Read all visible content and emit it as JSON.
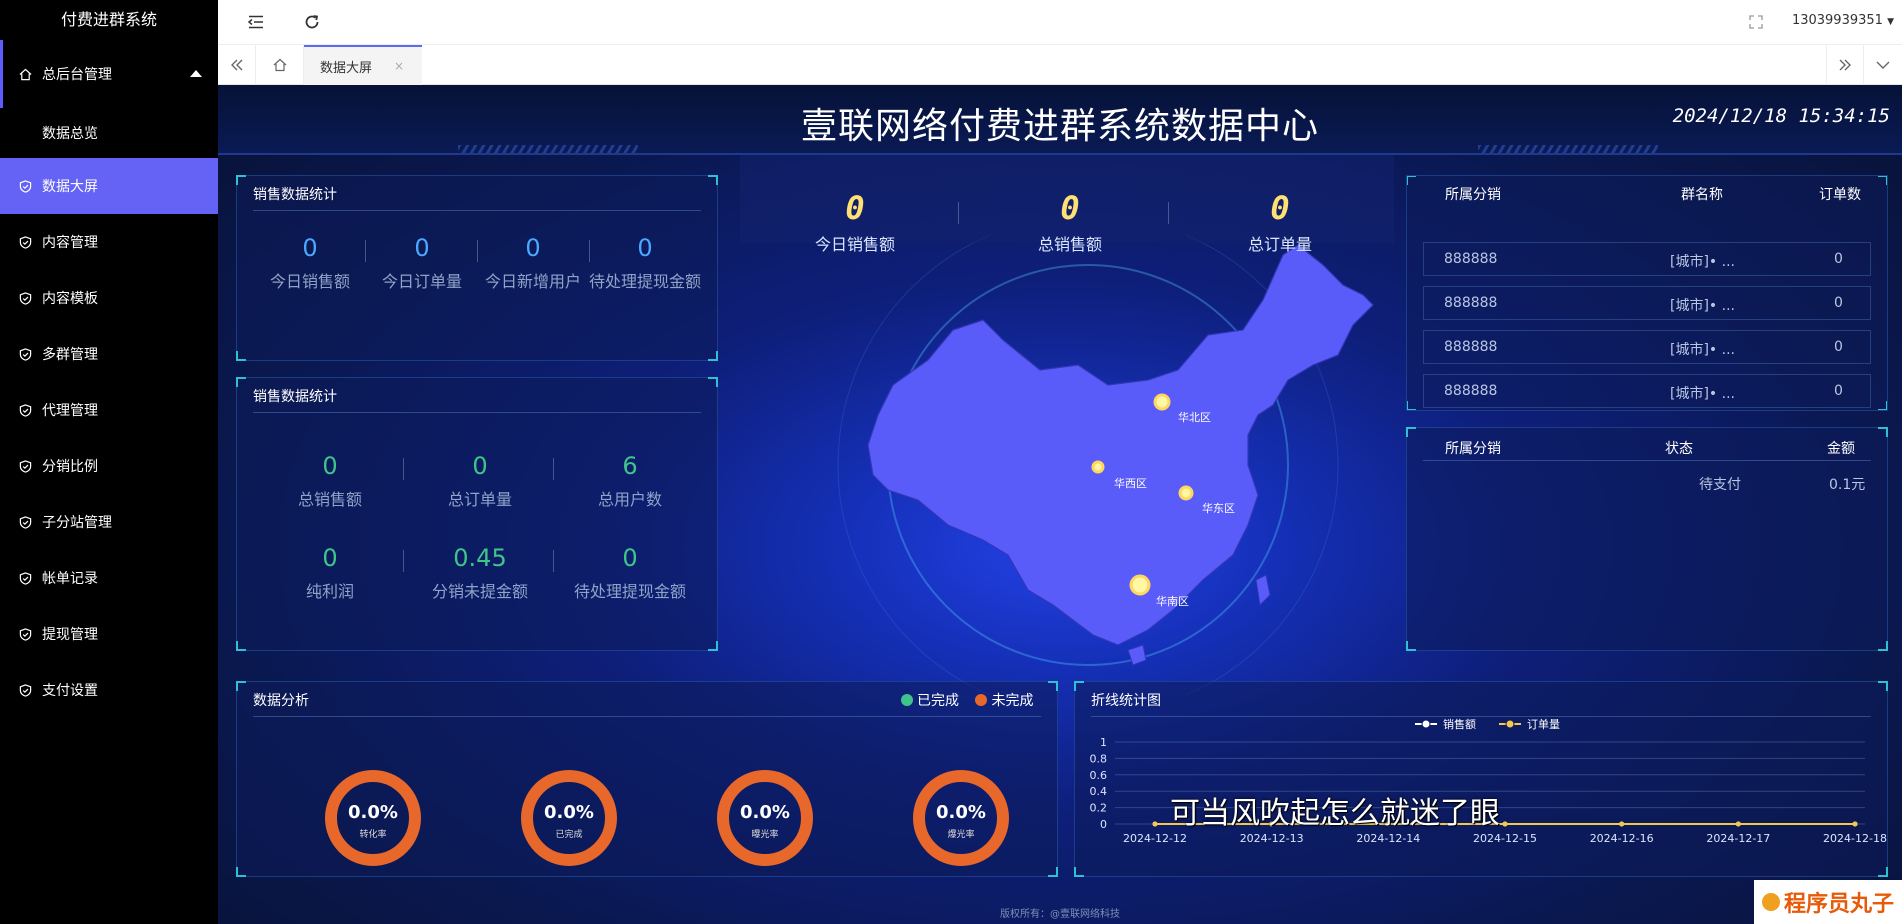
{
  "sidebar": {
    "brand": "付费进群系统",
    "items": [
      {
        "label": "总后台管理"
      },
      {
        "label": "数据总览"
      },
      {
        "label": "数据大屏"
      },
      {
        "label": "内容管理"
      },
      {
        "label": "内容模板"
      },
      {
        "label": "多群管理"
      },
      {
        "label": "代理管理"
      },
      {
        "label": "分销比例"
      },
      {
        "label": "子分站管理"
      },
      {
        "label": "帐单记录"
      },
      {
        "label": "提现管理"
      },
      {
        "label": "支付设置"
      }
    ]
  },
  "topbar": {
    "user": "13039939351"
  },
  "tabs": {
    "active": "数据大屏",
    "close": "×"
  },
  "dashboard": {
    "title": "壹联网络付费进群系统数据中心",
    "time": "2024/12/18 15:34:15",
    "sales_panel": {
      "title": "销售数据统计",
      "stats": [
        {
          "value": "0",
          "label": "今日销售额"
        },
        {
          "value": "0",
          "label": "今日订单量"
        },
        {
          "value": "0",
          "label": "今日新增用户"
        },
        {
          "value": "0",
          "label": "待处理提现金额"
        }
      ]
    },
    "sales_panel2": {
      "title": "销售数据统计",
      "stats": [
        {
          "value": "0",
          "label": "总销售额"
        },
        {
          "value": "0",
          "label": "总订单量"
        },
        {
          "value": "6",
          "label": "总用户数"
        },
        {
          "value": "0",
          "label": "纯利润"
        },
        {
          "value": "0.45",
          "label": "分销未提金额"
        },
        {
          "value": "0",
          "label": "待处理提现金额"
        }
      ]
    },
    "kpis": [
      {
        "value": "0",
        "label": "今日销售额"
      },
      {
        "value": "0",
        "label": "总销售额"
      },
      {
        "value": "0",
        "label": "总订单量"
      }
    ],
    "map_regions": [
      "华北区",
      "华西区",
      "华东区",
      "华南区"
    ],
    "table1": {
      "headers": [
        "所属分销",
        "群名称",
        "订单数"
      ],
      "rows": [
        [
          "888888",
          "[城市]• ...",
          "0"
        ],
        [
          "888888",
          "[城市]• ...",
          "0"
        ],
        [
          "888888",
          "[城市]• ...",
          "0"
        ],
        [
          "888888",
          "[城市]• ...",
          "0"
        ]
      ]
    },
    "table2": {
      "headers": [
        "所属分销",
        "状态",
        "金额"
      ],
      "rows": [
        [
          "",
          "待支付",
          "0.1元"
        ]
      ]
    },
    "analysis": {
      "title": "数据分析",
      "legend": [
        {
          "label": "已完成",
          "color": "#3fc48a"
        },
        {
          "label": "未完成",
          "color": "#e8672b"
        }
      ],
      "donuts": [
        {
          "value": "0.0%",
          "label": "转化率"
        },
        {
          "value": "0.0%",
          "label": "已完成"
        },
        {
          "value": "0.0%",
          "label": "曝光率"
        },
        {
          "value": "0.0%",
          "label": "爆光率"
        }
      ]
    },
    "line_chart": {
      "title": "折线统计图"
    },
    "footer": "版权所有：@壹联网络科技"
  },
  "chart_data": {
    "type": "line",
    "legend": [
      "销售额",
      "订单量"
    ],
    "x": [
      "2024-12-12",
      "2024-12-13",
      "2024-12-14",
      "2024-12-15",
      "2024-12-16",
      "2024-12-17",
      "2024-12-18"
    ],
    "ylim": [
      0,
      1
    ],
    "yticks": [
      "1",
      "0.8",
      "0.6",
      "0.4",
      "0.2",
      "0"
    ],
    "series": [
      {
        "name": "销售额",
        "values": [
          0,
          0,
          0,
          0,
          0,
          0,
          0
        ],
        "color": "#ffffff"
      },
      {
        "name": "订单量",
        "values": [
          0,
          0,
          0,
          0,
          0,
          0,
          0
        ],
        "color": "#f2c94c"
      }
    ]
  },
  "overlay": {
    "subtitle": "可当风吹起怎么就迷了眼",
    "watermark": "程序员丸子"
  }
}
